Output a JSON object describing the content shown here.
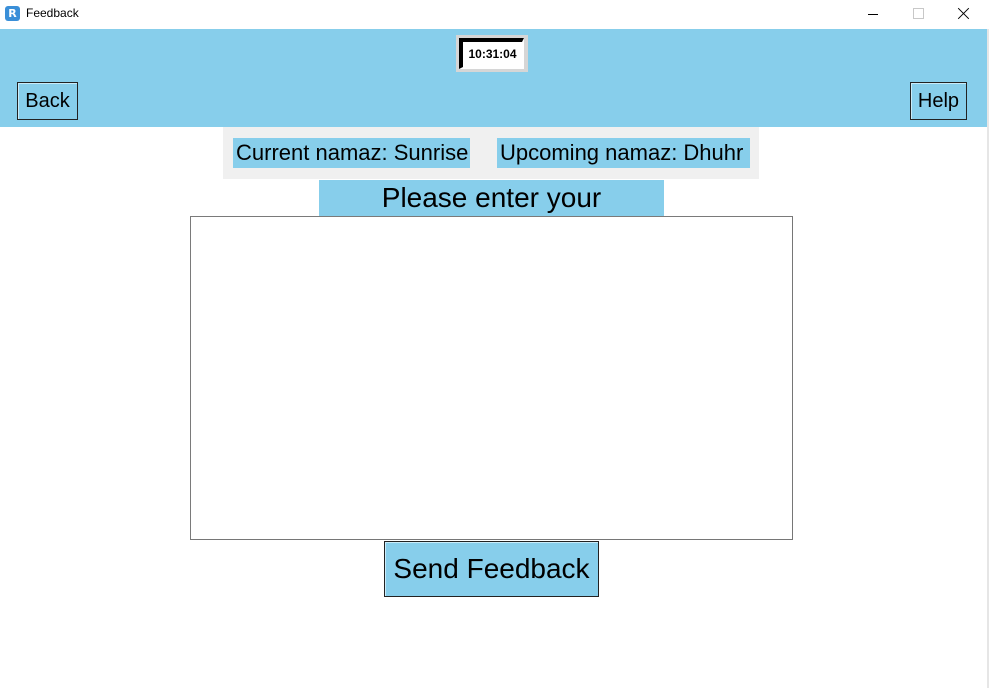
{
  "window": {
    "title": "Feedback",
    "app_icon": "app-icon"
  },
  "header": {
    "clock": "10:31:04",
    "back_label": "Back",
    "help_label": "Help",
    "bg_color": "#87ceeb"
  },
  "namaz": {
    "current": "Current namaz: Sunrise",
    "upcoming": "Upcoming namaz: Dhuhr"
  },
  "feedback": {
    "prompt": "Please enter your feedback:",
    "value": "",
    "send_label": "Send Feedback"
  }
}
